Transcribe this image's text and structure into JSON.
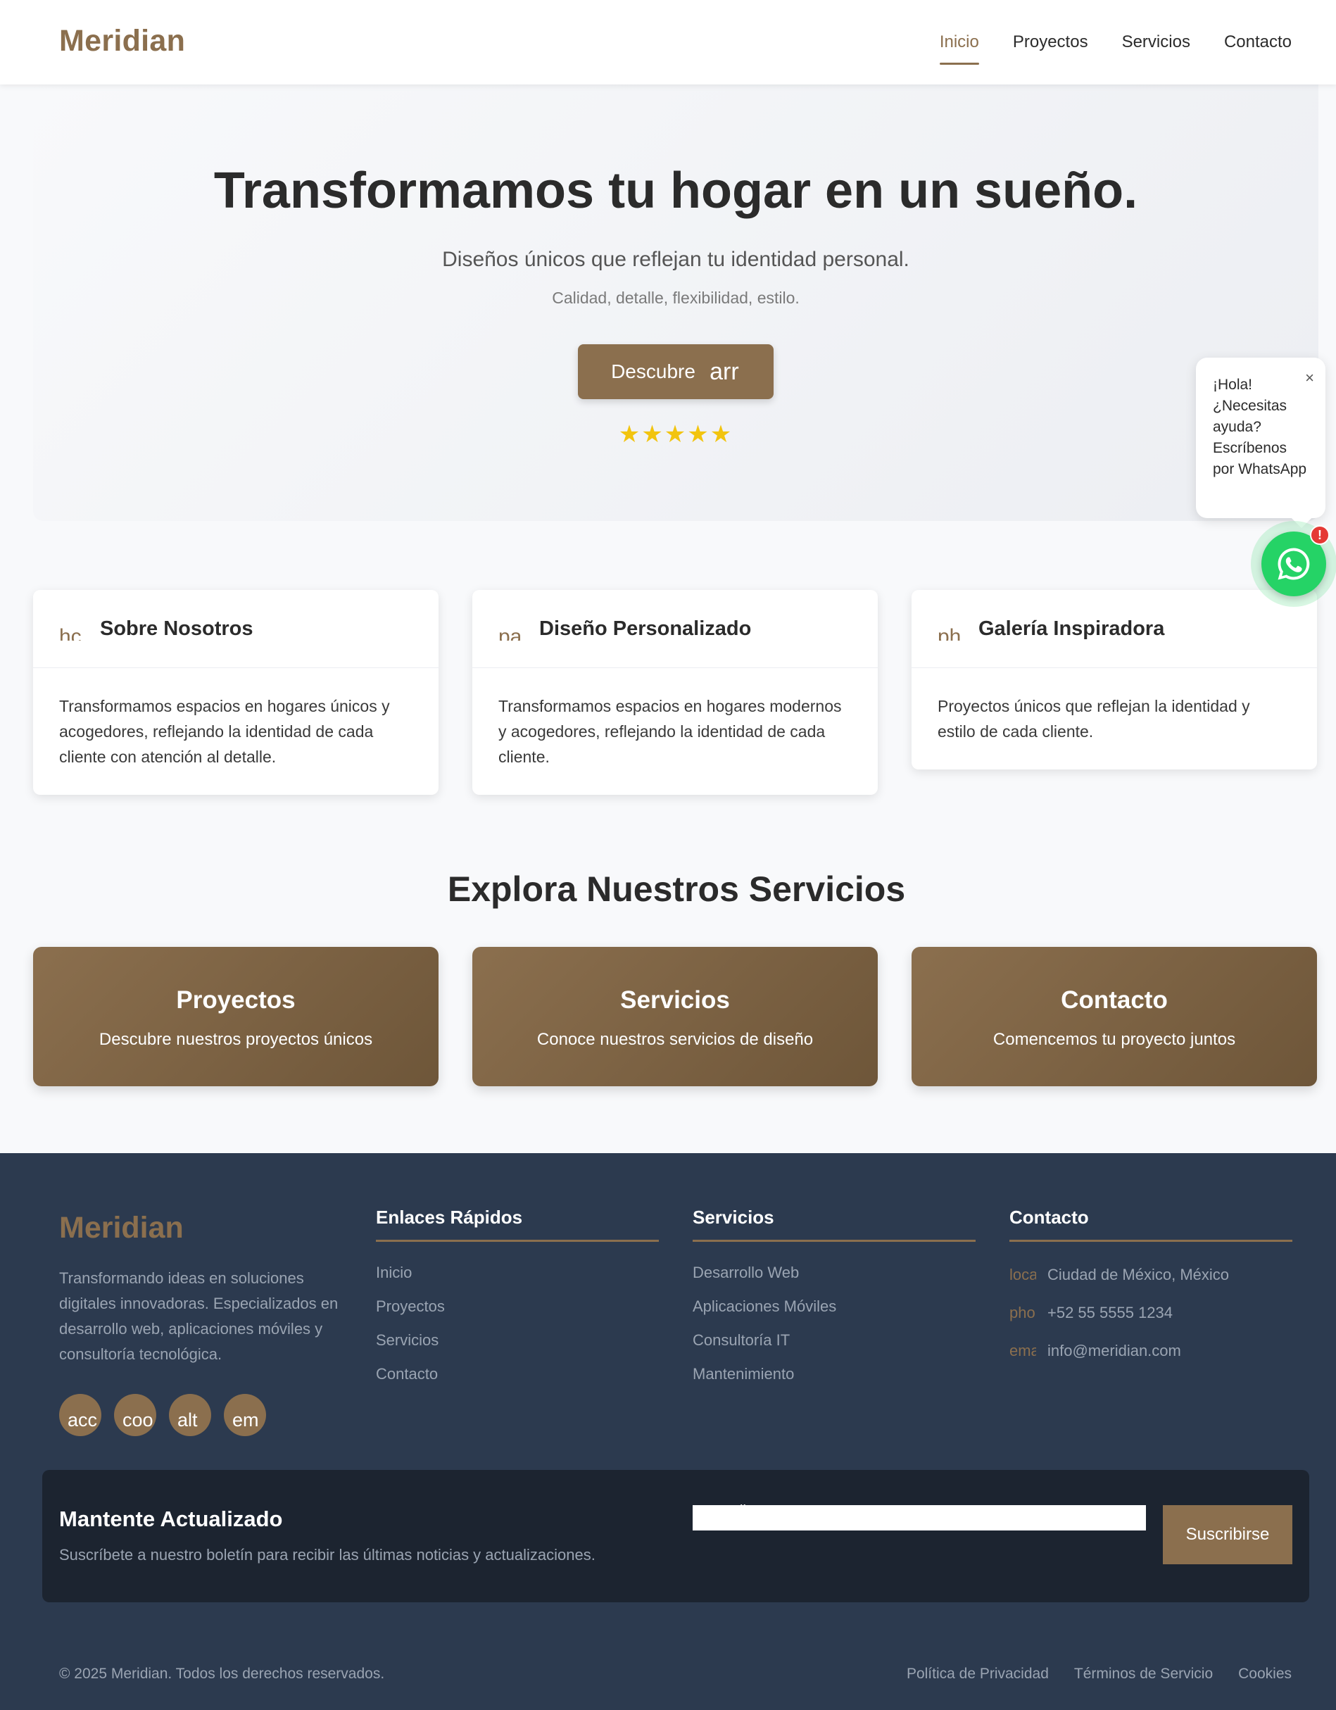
{
  "nav": {
    "brand": "Meridian",
    "links": [
      "Inicio",
      "Proyectos",
      "Servicios",
      "Contacto"
    ],
    "active": "Inicio"
  },
  "hero": {
    "title": "Transformamos tu hogar en un sueño.",
    "subtitle": "Diseños únicos que reflejan tu identidad personal.",
    "tagline": "Calidad, detalle, flexibilidad, estilo.",
    "button_label": "Descubre",
    "button_icon_text": "arr",
    "stars": "★★★★★",
    "rating": 5
  },
  "whatsapp": {
    "message": "¡Hola! ¿Necesitas ayuda? Escríbenos por WhatsApp",
    "close": "×",
    "badge": "!"
  },
  "features": [
    {
      "icon_text": "hc",
      "title": "Sobre Nosotros",
      "text": "Transformamos espacios en hogares únicos y acogedores, reflejando la identidad de cada cliente con atención al detalle."
    },
    {
      "icon_text": "pa",
      "title": "Diseño Personalizado",
      "text": "Transformamos espacios en hogares modernos y acogedores, reflejando la identidad de cada cliente."
    },
    {
      "icon_text": "ph",
      "title": "Galería Inspiradora",
      "text": "Proyectos únicos que reflejan la identidad y estilo de cada cliente."
    }
  ],
  "services_section": {
    "title": "Explora Nuestros Servicios",
    "items": [
      {
        "title": "Proyectos",
        "desc": "Descubre nuestros proyectos únicos"
      },
      {
        "title": "Servicios",
        "desc": "Conoce nuestros servicios de diseño"
      },
      {
        "title": "Contacto",
        "desc": "Comencemos tu proyecto juntos"
      }
    ]
  },
  "footer": {
    "brand": "Meridian",
    "desc": "Transformando ideas en soluciones digitales innovadoras. Especializados en desarrollo web, aplicaciones móviles y consultoría tecnológica.",
    "social": [
      "acc",
      "coo",
      "alt",
      "em"
    ],
    "quick_links": {
      "title": "Enlaces Rápidos",
      "items": [
        "Inicio",
        "Proyectos",
        "Servicios",
        "Contacto"
      ]
    },
    "services": {
      "title": "Servicios",
      "items": [
        "Desarrollo Web",
        "Aplicaciones Móviles",
        "Consultoría IT",
        "Mantenimiento"
      ]
    },
    "contact": {
      "title": "Contacto",
      "items": [
        {
          "icon_text": "loca",
          "value": "Ciudad de México, México"
        },
        {
          "icon_text": "pho",
          "value": "+52 55 5555 1234"
        },
        {
          "icon_text": "ema",
          "value": "info@meridian.com"
        }
      ]
    },
    "newsletter": {
      "title": "Mantente Actualizado",
      "desc": "Suscríbete a nuestro boletín para recibir las últimas noticias y actualizaciones.",
      "label": "Tu email*",
      "input_value": "",
      "button": "Suscribirse"
    },
    "copyright": "© 2025 Meridian. Todos los derechos reservados.",
    "legal": [
      "Política de Privacidad",
      "Términos de Servicio",
      "Cookies"
    ]
  },
  "colors": {
    "accent": "#8b6f4e",
    "footer_bg": "#2c3a4f",
    "newsletter_bg": "#1c2430",
    "whatsapp": "#25d366",
    "star": "#f2c40f"
  }
}
